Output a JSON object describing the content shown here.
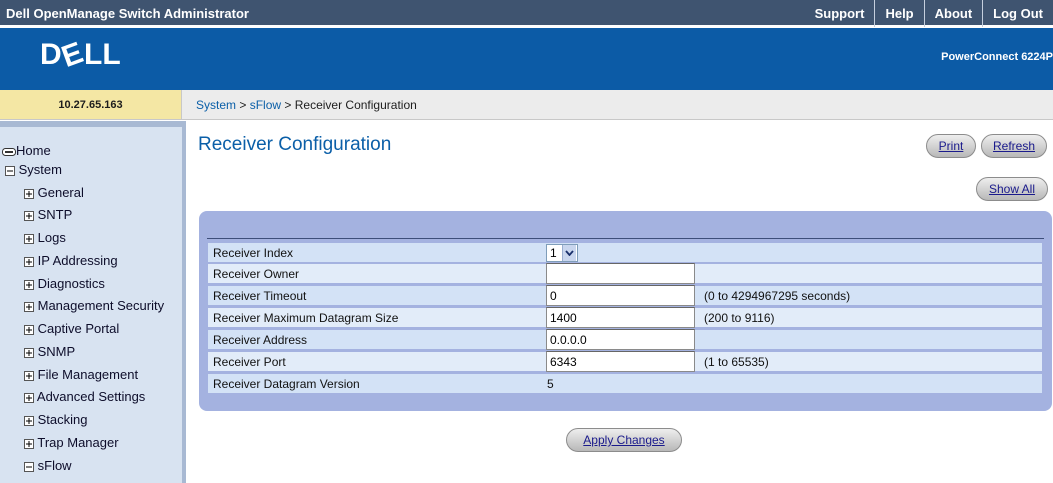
{
  "topbar": {
    "app_title": "Dell OpenManage Switch Administrator",
    "links": [
      "Support",
      "Help",
      "About",
      "Log Out"
    ]
  },
  "brand": {
    "logo_text": "DELL",
    "model": "PowerConnect 6224P"
  },
  "ip_address": "10.27.65.163",
  "breadcrumb": {
    "system": "System",
    "sep1": " > ",
    "sflow": "sFlow",
    "sep2": " > ",
    "current": "Receiver Configuration"
  },
  "nav": {
    "home": "Home",
    "system": "System",
    "items": [
      "General",
      "SNTP",
      "Logs",
      "IP Addressing",
      "Diagnostics",
      "Management Security",
      "Captive Portal",
      "SNMP",
      "File Management",
      "Advanced Settings",
      "Stacking",
      "Trap Manager",
      "sFlow"
    ]
  },
  "page": {
    "title": "Receiver Configuration",
    "print_label": "Print",
    "refresh_label": "Refresh",
    "show_all_label": "Show All",
    "apply_label": "Apply Changes"
  },
  "form": {
    "receiver_index": {
      "label": "Receiver Index",
      "value": "1"
    },
    "receiver_owner": {
      "label": "Receiver Owner",
      "value": ""
    },
    "receiver_timeout": {
      "label": "Receiver Timeout",
      "value": "0",
      "hint": "(0 to 4294967295 seconds)"
    },
    "max_datagram": {
      "label": "Receiver Maximum Datagram Size",
      "value": "1400",
      "hint": "(200 to 9116)"
    },
    "address": {
      "label": "Receiver Address",
      "value": "0.0.0.0"
    },
    "port": {
      "label": "Receiver Port",
      "value": "6343",
      "hint": "(1 to 65535)"
    },
    "datagram_version": {
      "label": "Receiver Datagram Version",
      "value": "5"
    }
  },
  "colors": {
    "topbar": "#3f5470",
    "brand_band": "#0c5ba6",
    "ip_cell": "#f4e7a4",
    "nav_bg": "#d8e3f1",
    "panel": "#a4b2e0",
    "title_blue": "#0b5fa8"
  },
  "icons": {
    "home": "home-icon",
    "tree_expand": "plus-box-icon",
    "tree_collapse": "minus-box-icon",
    "select": "chevron-down-icon"
  }
}
